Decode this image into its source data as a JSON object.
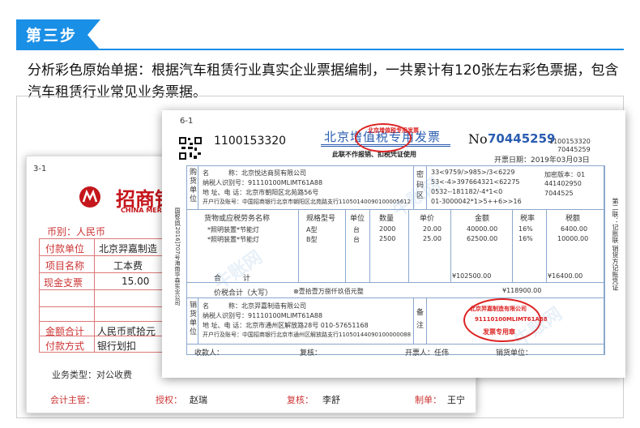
{
  "step": {
    "label": "第三步",
    "color": "#1a8fe6"
  },
  "intro": "分析彩色原始单据：根据汽车租赁行业真实企业票据编制，一共累计有120张左右彩色票据，包含汽车租赁行业常见业务票据。",
  "receipt": {
    "serial": "3-1",
    "bank_name": "招商银行",
    "bank_en": "CHINA MERCH",
    "currency": "币别：人民币",
    "rows": [
      {
        "label": "付款单位",
        "value": "北京羿嘉制造"
      },
      {
        "label": "项目名称",
        "value": "工本费"
      },
      {
        "label": "现金支票",
        "value": "15.00"
      },
      {
        "label": "",
        "value": ""
      },
      {
        "label": "",
        "value": ""
      },
      {
        "label": "金额合计",
        "value": "人民币贰拾元"
      },
      {
        "label": "付款方式",
        "value": "银行划扣"
      }
    ],
    "business_type": "业务类型：对公收费",
    "footer": [
      {
        "label": "会计主管：",
        "value": ""
      },
      {
        "label": "授权：",
        "value": "赵瑞"
      },
      {
        "label": "复核：",
        "value": "李舒"
      },
      {
        "label": "制单：",
        "value": "王宁"
      }
    ]
  },
  "invoice": {
    "serial": "6-1",
    "code": "1100153320",
    "title": "北京增值税专用发票",
    "subtitle": "此联不作报销、扣税凭证使用",
    "no_symbol": "No",
    "number": "70445259",
    "number_side": "1100153320",
    "number_side2": "70445259",
    "date": "开票日期：2019年03月03日",
    "buyer": {
      "side": [
        "购",
        "货",
        "单",
        "位"
      ],
      "name": "名　　　称：北京悦达商贸有限公司",
      "tax_id": "纳税人识别号：91110100MLIMT61A88",
      "address": "地 址、电 话：北京市朝阳区北苑路56号",
      "bank": "开户行及账号：中国招商银行北京市朝阳区北苑路支行11050140090100005612"
    },
    "cipher": {
      "label": [
        "密",
        "码",
        "区"
      ],
      "lines": [
        "33<9759/>985>/3<6229",
        "53<-4>397664321<62275",
        "0532--181182/-4*1<0",
        "01-3000042*1>5++6>>16"
      ],
      "version": "加密版本：01",
      "v1": "441402950",
      "v2": "7044525"
    },
    "headers": [
      "货物或应税劳务名称",
      "规格型号",
      "单位",
      "数量",
      "单价",
      "金额",
      "税率",
      "税额"
    ],
    "items": [
      {
        "name": "*照明装置*节能灯",
        "spec": "A型",
        "unit": "台",
        "qty": "2000",
        "price": "20.00",
        "amount": "40000.00",
        "rate": "16%",
        "tax": "6400.00"
      },
      {
        "name": "*照明装置*节能灯",
        "spec": "B型",
        "unit": "台",
        "qty": "2500",
        "price": "25.00",
        "amount": "62500.00",
        "rate": "16%",
        "tax": "10000.00"
      }
    ],
    "total_label": "合　　　计",
    "total_amount": "¥102500.00",
    "total_tax": "¥16400.00",
    "grand_label": "价税合计（大写）",
    "grand_words": "⊗壹拾壹万捌仟玖佰元整",
    "grand_small": "¥118900.00",
    "seller": {
      "side": [
        "销",
        "货",
        "单",
        "位"
      ],
      "name": "名　　　称：北京羿嘉制造有限公司",
      "tax_id": "纳税人识别号：91110100MLIMT61A88",
      "address": "地 址、电 话：北京市通州区解放路28号 010-57651168",
      "bank": "开户行及账号：中国招商银行北京市通州区解放路支行11050144090100000088"
    },
    "note_label": [
      "备",
      "注"
    ],
    "footer": [
      "收款人：",
      "复核：",
      "开票人：任伟",
      "销货单位："
    ],
    "left_vertical": "国税函[2016]707号海南华森实业公司",
    "right_vertical": "第二联：记账联 销货方记账凭证",
    "stamp_top": "北京增值税专用发票",
    "stamp_seller": [
      "北京羿嘉制造有限公司",
      "91110100MLIMT61A88",
      "发票专用章"
    ]
  },
  "watermark": "牛账网"
}
